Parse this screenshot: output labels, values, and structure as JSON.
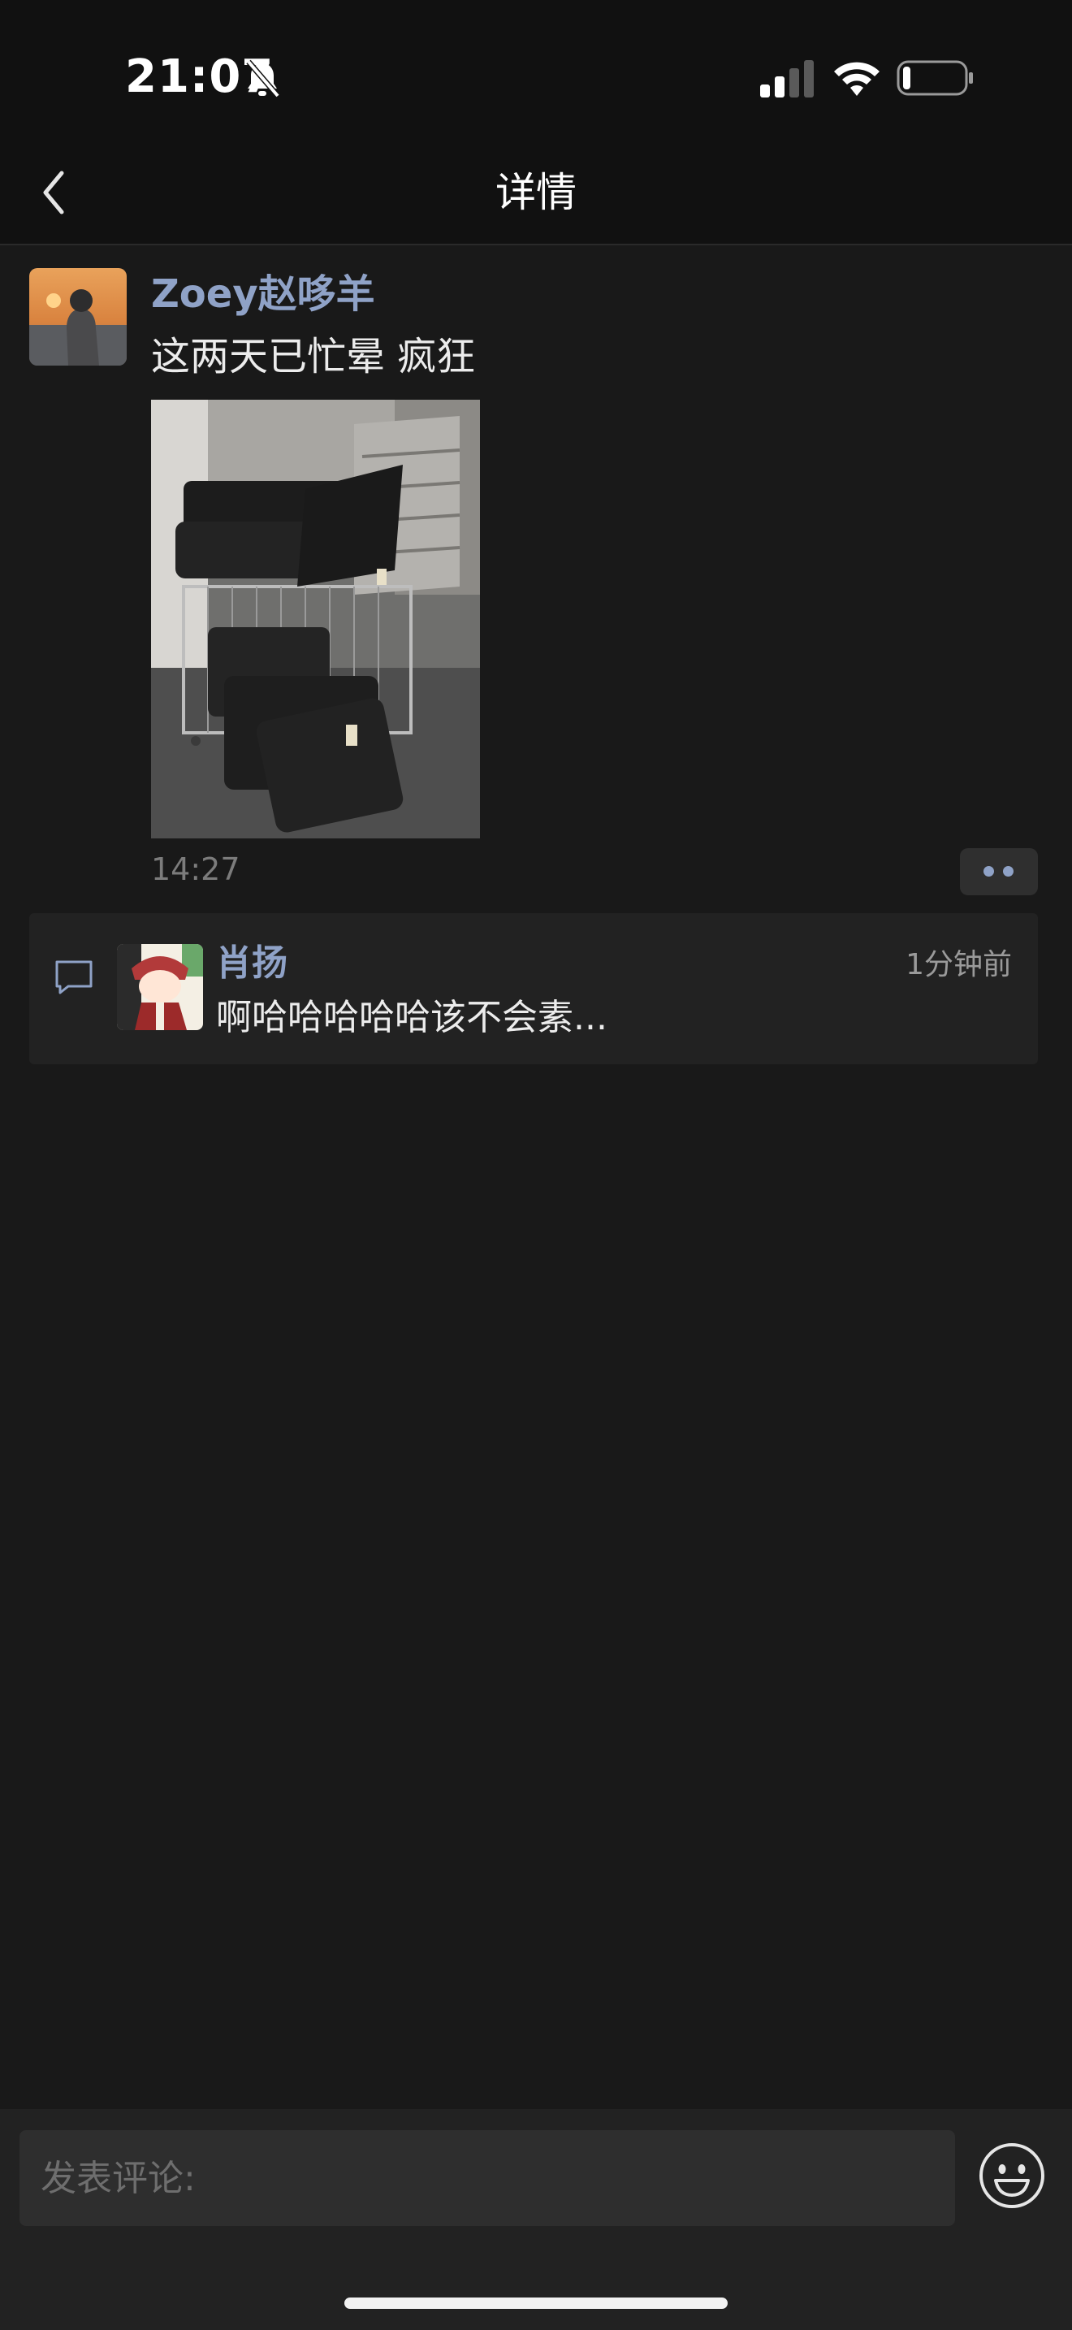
{
  "status_bar": {
    "time": "21:07",
    "battery_level": 0.12
  },
  "nav": {
    "title": "详情"
  },
  "post": {
    "author": "Zoey赵哆羊",
    "text": "这两天已忙晕 疯狂",
    "time": "14:27"
  },
  "comments": [
    {
      "name": "肖扬",
      "time": "1分钟前",
      "text": "啊哈哈哈哈哈该不会素..."
    }
  ],
  "input": {
    "placeholder": "发表评论:"
  },
  "icons": {
    "back": "chevron-left-icon",
    "mute": "bell-slash-icon",
    "comment": "speech-bubble-icon",
    "emoji": "smiley-icon"
  },
  "colors": {
    "link": "#8fa2c7",
    "background": "#191919"
  }
}
